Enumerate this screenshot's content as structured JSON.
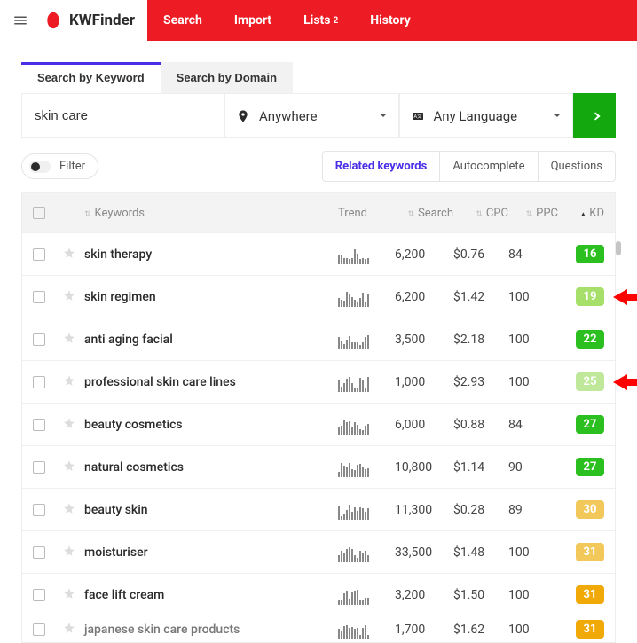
{
  "brand": {
    "name": "KWFinder"
  },
  "nav": {
    "search": "Search",
    "import": "Import",
    "lists": "Lists",
    "lists_badge": "2",
    "history": "History"
  },
  "search_tabs": {
    "keyword": "Search by Keyword",
    "domain": "Search by Domain"
  },
  "search": {
    "query": "skin care",
    "location": "Anywhere",
    "language": "Any Language"
  },
  "controls": {
    "filter": "Filter",
    "related": "Related keywords",
    "autocomplete": "Autocomplete",
    "questions": "Questions"
  },
  "columns": {
    "keywords": "Keywords",
    "trend": "Trend",
    "search": "Search",
    "cpc": "CPC",
    "ppc": "PPC",
    "kd": "KD"
  },
  "rows": [
    {
      "kw": "skin therapy",
      "search": "6,200",
      "cpc": "$0.76",
      "ppc": "84",
      "kd": "16",
      "kd_color": "#2bbf1f",
      "callout": false
    },
    {
      "kw": "skin regimen",
      "search": "6,200",
      "cpc": "$1.42",
      "ppc": "100",
      "kd": "19",
      "kd_color": "#a6e06a",
      "callout": true
    },
    {
      "kw": "anti aging facial",
      "search": "3,500",
      "cpc": "$2.18",
      "ppc": "100",
      "kd": "22",
      "kd_color": "#2bbf1f",
      "callout": false
    },
    {
      "kw": "professional skin care lines",
      "search": "1,000",
      "cpc": "$2.93",
      "ppc": "100",
      "kd": "25",
      "kd_color": "#bfe89a",
      "callout": true
    },
    {
      "kw": "beauty cosmetics",
      "search": "6,000",
      "cpc": "$0.88",
      "ppc": "84",
      "kd": "27",
      "kd_color": "#2bbf1f",
      "callout": false
    },
    {
      "kw": "natural cosmetics",
      "search": "10,800",
      "cpc": "$1.14",
      "ppc": "90",
      "kd": "27",
      "kd_color": "#2bbf1f",
      "callout": false
    },
    {
      "kw": "beauty skin",
      "search": "11,300",
      "cpc": "$0.28",
      "ppc": "89",
      "kd": "30",
      "kd_color": "#f3c85a",
      "callout": false
    },
    {
      "kw": "moisturiser",
      "search": "33,500",
      "cpc": "$1.48",
      "ppc": "100",
      "kd": "31",
      "kd_color": "#f3c85a",
      "callout": false
    },
    {
      "kw": "face lift cream",
      "search": "3,200",
      "cpc": "$1.50",
      "ppc": "100",
      "kd": "31",
      "kd_color": "#f0a907",
      "callout": false
    },
    {
      "kw": "japanese skin care products",
      "search": "1,700",
      "cpc": "$1.62",
      "ppc": "100",
      "kd": "31",
      "kd_color": "#f0a907",
      "callout": false
    }
  ]
}
